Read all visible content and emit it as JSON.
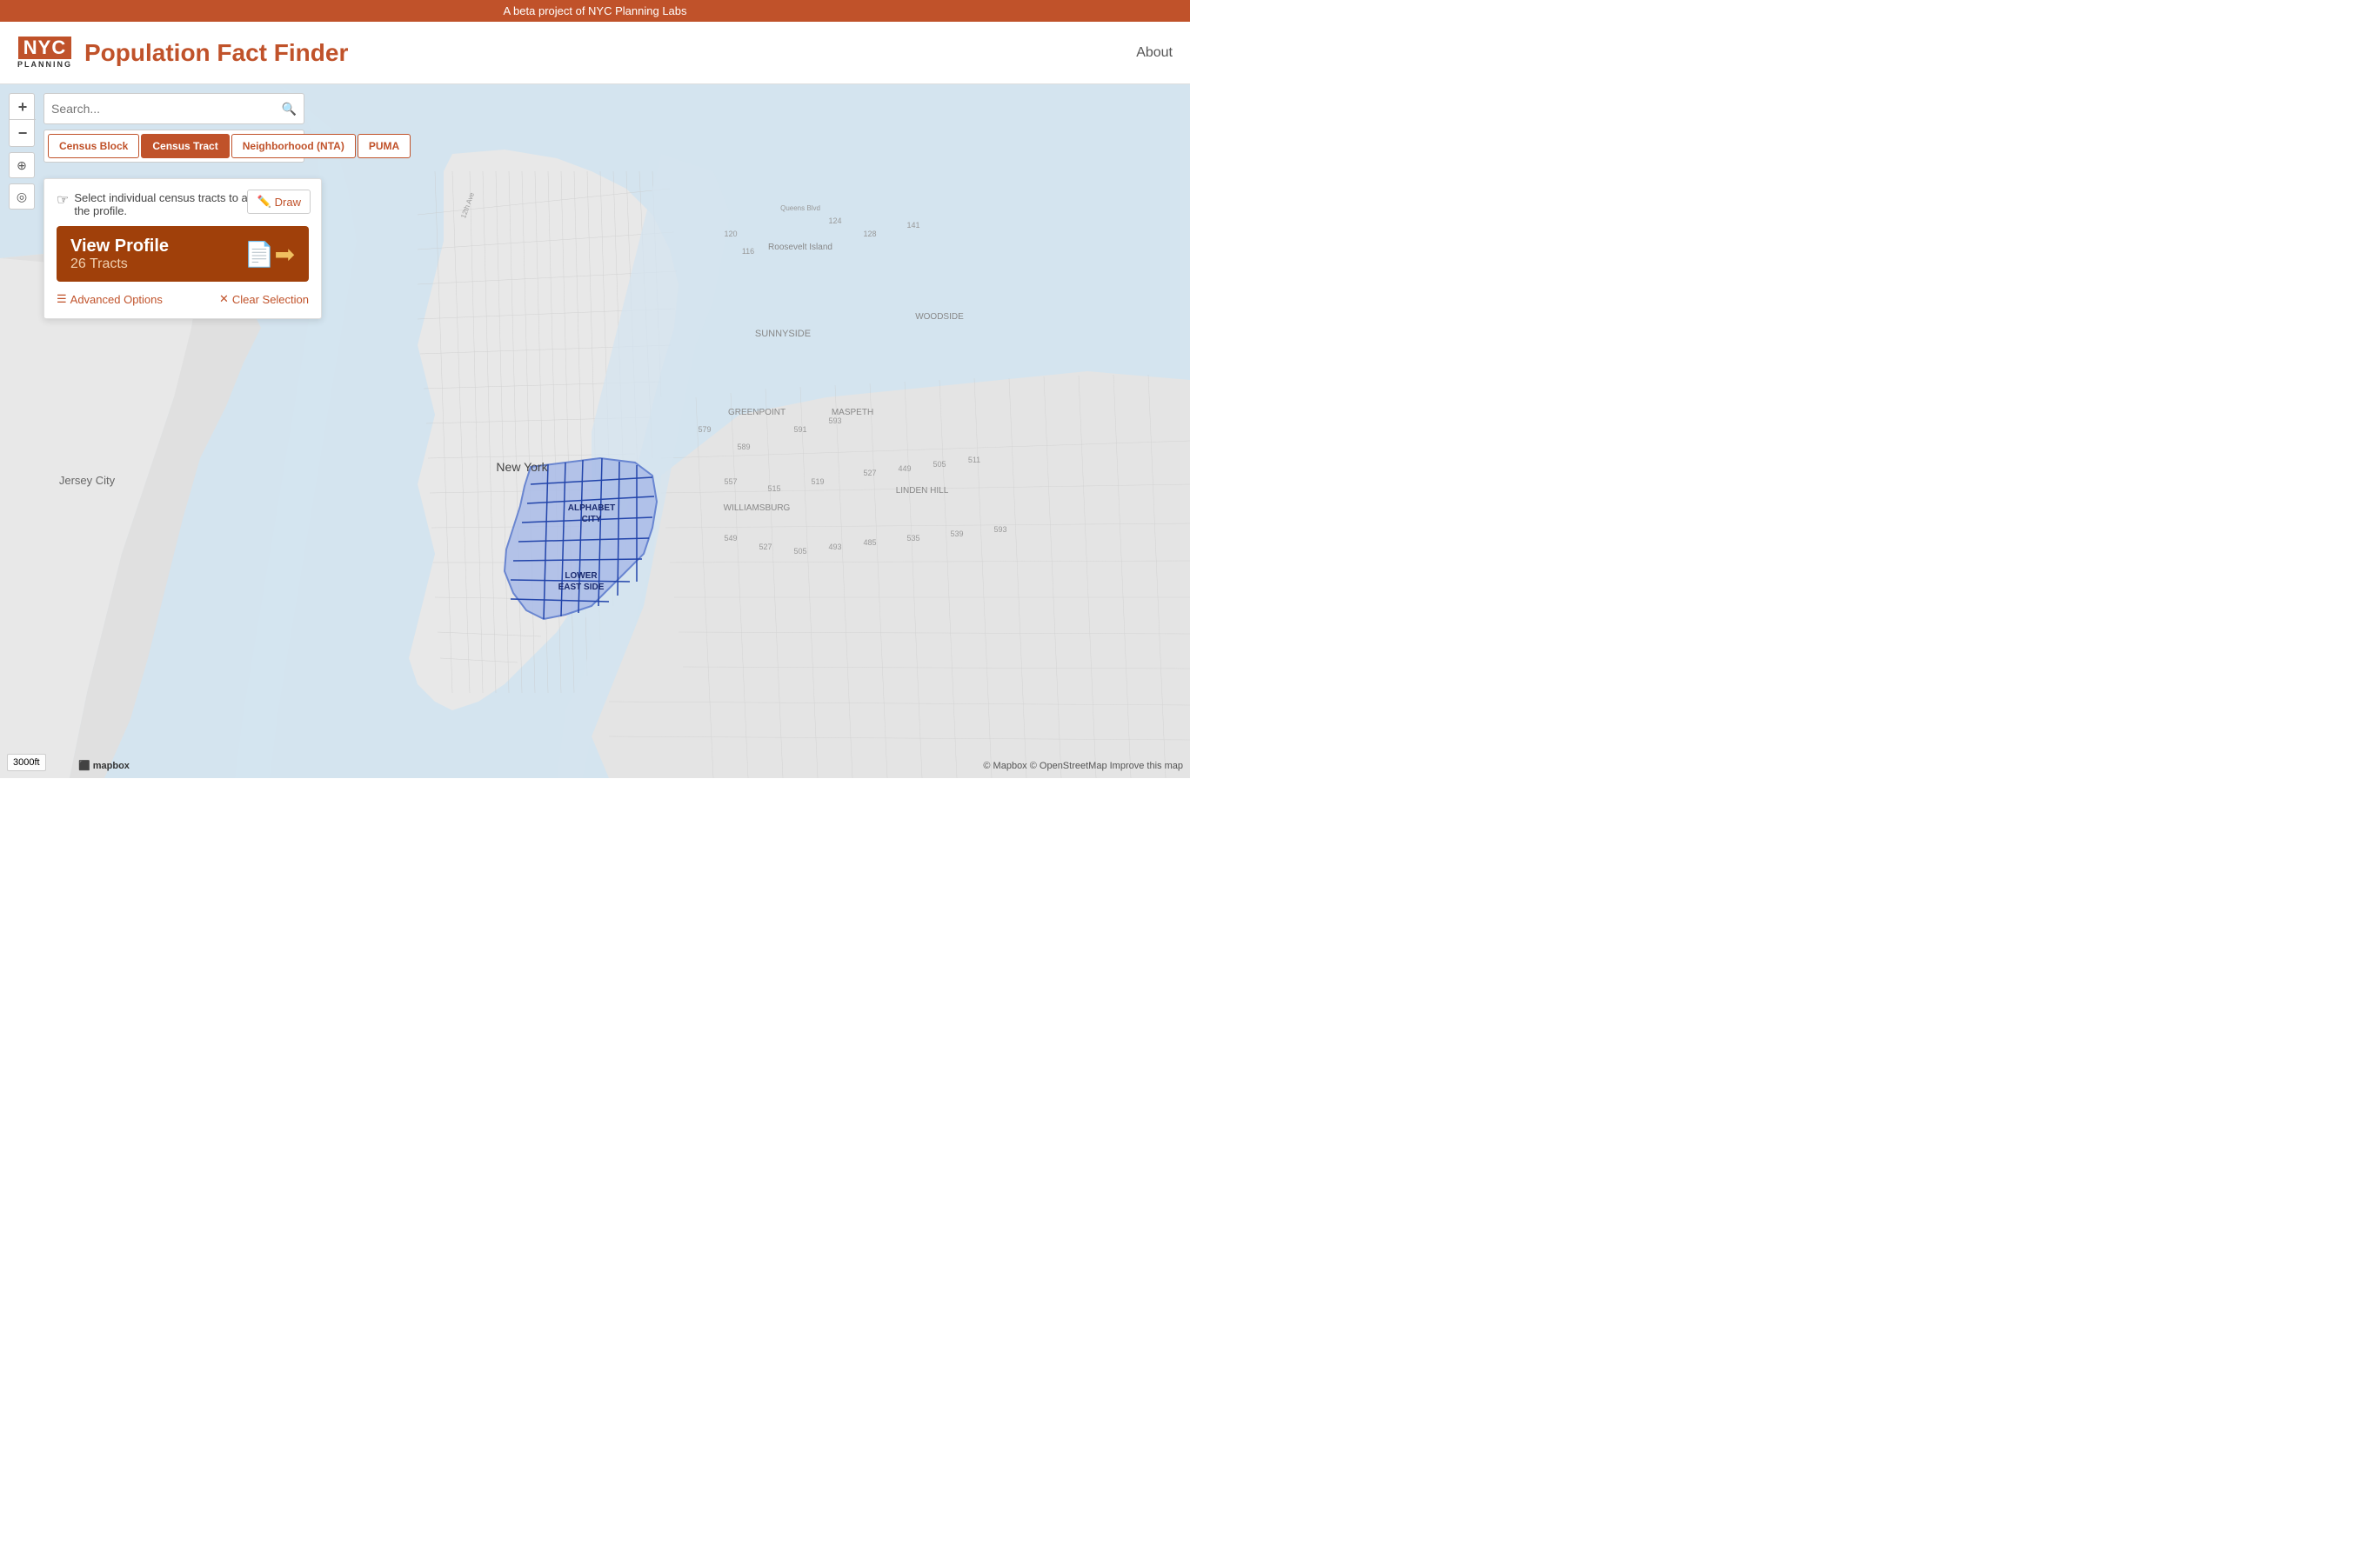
{
  "banner": {
    "text": "A beta project of NYC Planning Labs"
  },
  "header": {
    "logo_top": "NYC",
    "logo_bottom": "PLANNING",
    "title": "Population Fact Finder",
    "about_label": "About"
  },
  "search": {
    "placeholder": "Search..."
  },
  "geo_tabs": [
    {
      "id": "census-block",
      "label": "Census Block",
      "active": false
    },
    {
      "id": "census-tract",
      "label": "Census Tract",
      "active": true
    },
    {
      "id": "neighborhood",
      "label": "Neighborhood (NTA)",
      "active": false
    },
    {
      "id": "puma",
      "label": "PUMA",
      "active": false
    }
  ],
  "selection_panel": {
    "instructions": "Select individual census tracts to add them to the profile.",
    "draw_label": "Draw",
    "view_profile_label": "View Profile",
    "view_profile_count": "26 Tracts",
    "advanced_options_label": "Advanced Options",
    "clear_selection_label": "Clear Selection"
  },
  "map": {
    "highlighted_area": "Alphabet City / Lower East Side",
    "scale_label": "3000ft",
    "credit_text": "© Mapbox © OpenStreetMap",
    "improve_label": "Improve this map"
  },
  "zoom_controls": {
    "plus_label": "+",
    "minus_label": "−"
  }
}
